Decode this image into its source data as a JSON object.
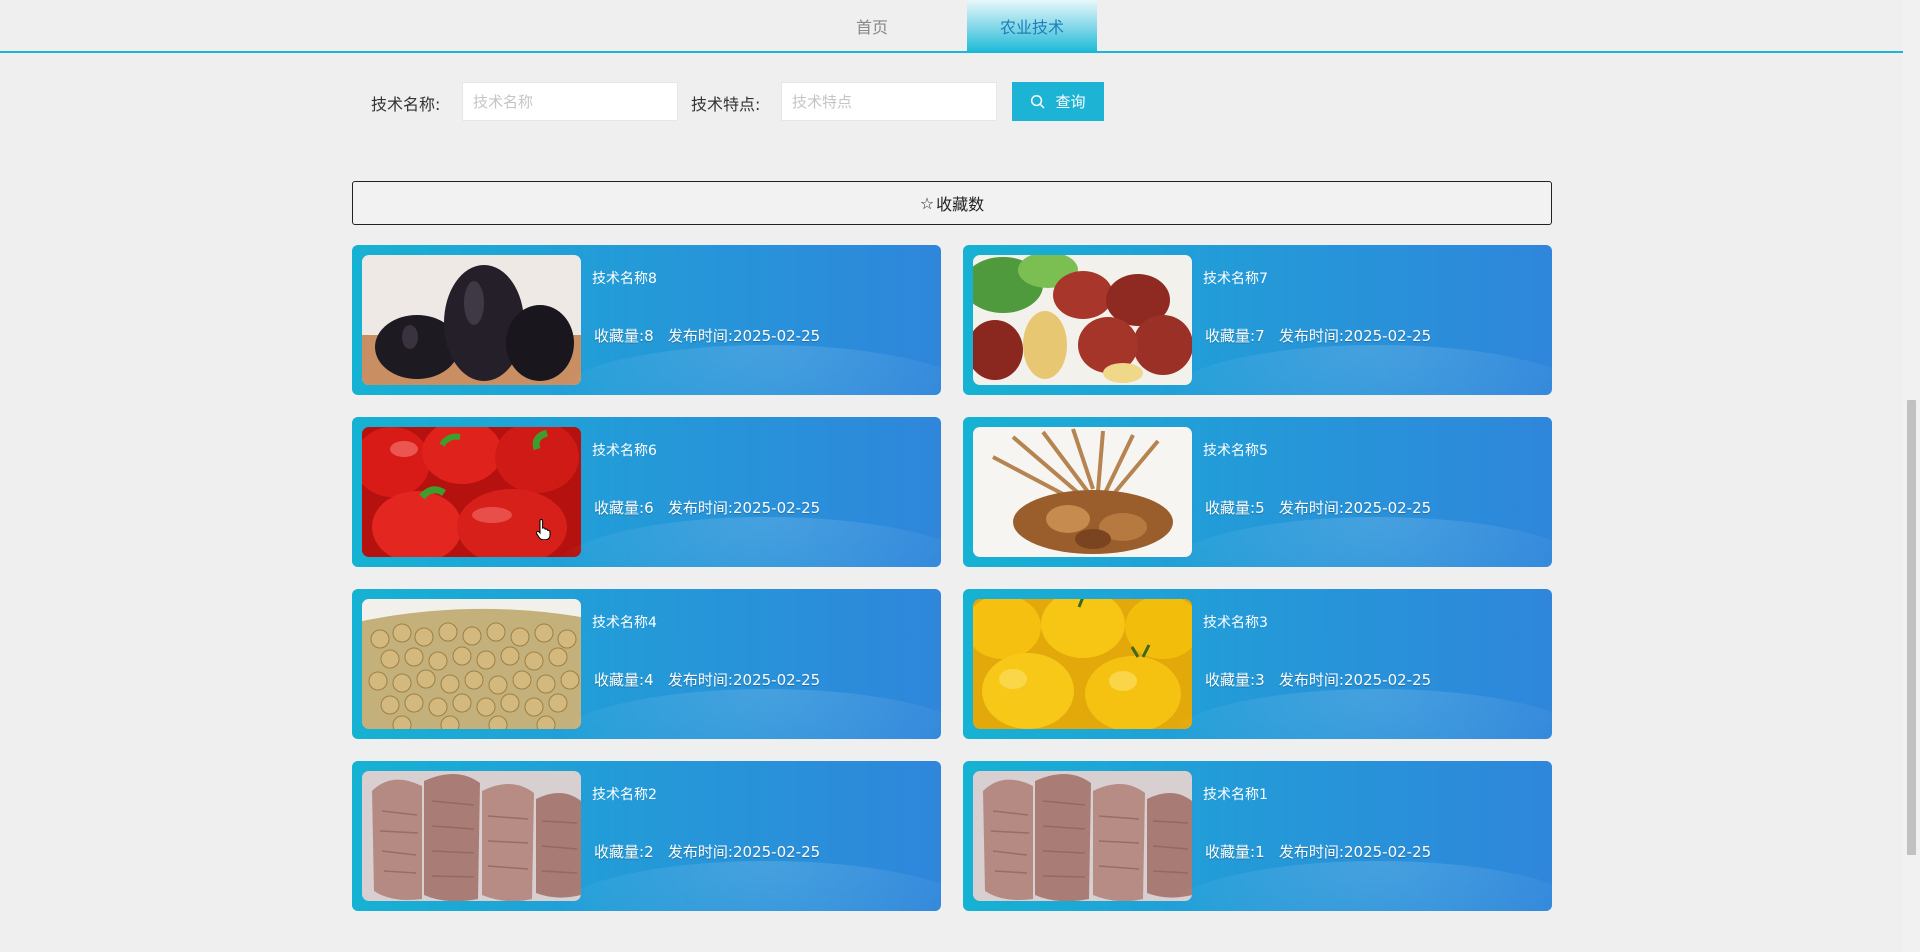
{
  "nav": {
    "tabs": [
      {
        "label": "首页"
      },
      {
        "label": "农业技术"
      }
    ]
  },
  "search": {
    "name_label": "技术名称:",
    "name_placeholder": "技术名称",
    "feature_label": "技术特点:",
    "feature_placeholder": "技术特点",
    "query_label": "查询"
  },
  "sort": {
    "label": "收藏数",
    "icon": "star-outline-icon"
  },
  "cards": [
    {
      "title": "技术名称8",
      "fav_label": "收藏量:",
      "fav_count": "8",
      "date_label": "发布时间:",
      "date": "2025-02-25",
      "image": "prunes"
    },
    {
      "title": "技术名称7",
      "fav_label": "收藏量:",
      "fav_count": "7",
      "date_label": "发布时间:",
      "date": "2025-02-25",
      "image": "red-dates"
    },
    {
      "title": "技术名称6",
      "fav_label": "收藏量:",
      "fav_count": "6",
      "date_label": "发布时间:",
      "date": "2025-02-25",
      "image": "red-peppers"
    },
    {
      "title": "技术名称5",
      "fav_label": "收藏量:",
      "fav_count": "5",
      "date_label": "发布时间:",
      "date": "2025-02-25",
      "image": "dried-mushrooms"
    },
    {
      "title": "技术名称4",
      "fav_label": "收藏量:",
      "fav_count": "4",
      "date_label": "发布时间:",
      "date": "2025-02-25",
      "image": "chickpeas"
    },
    {
      "title": "技术名称3",
      "fav_label": "收藏量:",
      "fav_count": "3",
      "date_label": "发布时间:",
      "date": "2025-02-25",
      "image": "yellow-fruit"
    },
    {
      "title": "技术名称2",
      "fav_label": "收藏量:",
      "fav_count": "2",
      "date_label": "发布时间:",
      "date": "2025-02-25",
      "image": "dried-roots"
    },
    {
      "title": "技术名称1",
      "fav_label": "收藏量:",
      "fav_count": "1",
      "date_label": "发布时间:",
      "date": "2025-02-25",
      "image": "dried-roots"
    }
  ],
  "colors": {
    "accent": "#1cb3d4",
    "card_gradient_start": "#16b2d3",
    "card_gradient_end": "#2f86db"
  }
}
